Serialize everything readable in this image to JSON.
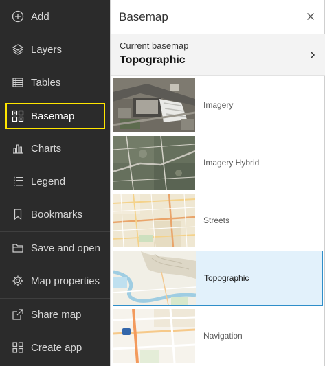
{
  "sidebar": {
    "items": [
      {
        "label": "Add",
        "icon": "plus-circle-icon"
      },
      {
        "label": "Layers",
        "icon": "layers-icon"
      },
      {
        "label": "Tables",
        "icon": "table-icon"
      },
      {
        "label": "Basemap",
        "icon": "basemap-icon",
        "active": true
      },
      {
        "label": "Charts",
        "icon": "bar-chart-icon"
      },
      {
        "label": "Legend",
        "icon": "legend-icon"
      },
      {
        "label": "Bookmarks",
        "icon": "bookmark-icon"
      },
      {
        "label": "Save and open",
        "icon": "folder-icon"
      },
      {
        "label": "Map properties",
        "icon": "gear-icon"
      },
      {
        "label": "Share map",
        "icon": "share-icon"
      },
      {
        "label": "Create app",
        "icon": "apps-icon"
      }
    ]
  },
  "panel": {
    "title": "Basemap",
    "current_label": "Current basemap",
    "current_value": "Topographic"
  },
  "basemaps": [
    {
      "label": "Imagery"
    },
    {
      "label": "Imagery Hybrid"
    },
    {
      "label": "Streets"
    },
    {
      "label": "Topographic",
      "selected": true
    },
    {
      "label": "Navigation"
    }
  ],
  "colors": {
    "sidebar_bg": "#2b2b2b",
    "highlight": "#ffe600",
    "selected_bg": "#e2f1fb",
    "selected_border": "#2f8ec9"
  }
}
